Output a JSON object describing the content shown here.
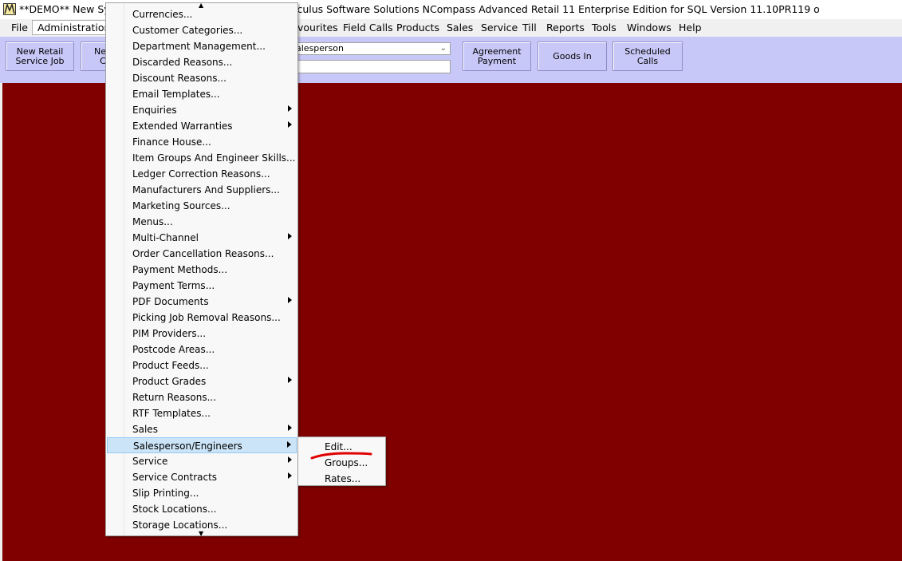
{
  "titlebar": {
    "left_text": "**DEMO** New Syst",
    "right_text": "lculus Software Solutions NCompass Advanced Retail 11 Enterprise Edition for SQL Version 11.10PR119 o"
  },
  "menubar": {
    "items": [
      "File",
      "Administration",
      "vourites",
      "Field Calls",
      "Products",
      "Sales",
      "Service",
      "Till",
      "Reports",
      "Tools",
      "Windows",
      "Help"
    ]
  },
  "toolbar": {
    "new_retail_service_job": "New Retail Service Job",
    "partial_button": "Ne C",
    "salesperson_select": "alesperson",
    "agreement_payment": "Agreement Payment",
    "goods_in": "Goods In",
    "scheduled_calls": "Scheduled Calls"
  },
  "admin_menu": {
    "items": [
      {
        "label": "Currencies...",
        "submenu": false
      },
      {
        "label": "Customer Categories...",
        "submenu": false
      },
      {
        "label": "Department Management...",
        "submenu": false
      },
      {
        "label": "Discarded Reasons...",
        "submenu": false
      },
      {
        "label": "Discount Reasons...",
        "submenu": false
      },
      {
        "label": "Email Templates...",
        "submenu": false
      },
      {
        "label": "Enquiries",
        "submenu": true
      },
      {
        "label": "Extended Warranties",
        "submenu": true
      },
      {
        "label": "Finance House...",
        "submenu": false
      },
      {
        "label": "Item Groups And Engineer Skills...",
        "submenu": false
      },
      {
        "label": "Ledger Correction Reasons...",
        "submenu": false
      },
      {
        "label": "Manufacturers And Suppliers...",
        "submenu": false
      },
      {
        "label": "Marketing Sources...",
        "submenu": false
      },
      {
        "label": "Menus...",
        "submenu": false
      },
      {
        "label": "Multi-Channel",
        "submenu": true
      },
      {
        "label": "Order Cancellation Reasons...",
        "submenu": false
      },
      {
        "label": "Payment Methods...",
        "submenu": false
      },
      {
        "label": "Payment Terms...",
        "submenu": false
      },
      {
        "label": "PDF Documents",
        "submenu": true
      },
      {
        "label": "Picking Job Removal Reasons...",
        "submenu": false
      },
      {
        "label": "PIM Providers...",
        "submenu": false
      },
      {
        "label": "Postcode Areas...",
        "submenu": false
      },
      {
        "label": "Product Feeds...",
        "submenu": false
      },
      {
        "label": "Product Grades",
        "submenu": true
      },
      {
        "label": "Return Reasons...",
        "submenu": false
      },
      {
        "label": "RTF Templates...",
        "submenu": false
      },
      {
        "label": "Sales",
        "submenu": true
      },
      {
        "label": "Salesperson/Engineers",
        "submenu": true,
        "highlighted": true
      },
      {
        "label": "Service",
        "submenu": true
      },
      {
        "label": "Service Contracts",
        "submenu": true
      },
      {
        "label": "Slip Printing...",
        "submenu": false
      },
      {
        "label": "Stock Locations...",
        "submenu": false
      },
      {
        "label": "Storage Locations...",
        "submenu": false
      }
    ]
  },
  "salesperson_submenu": {
    "items": [
      "Edit...",
      "Groups...",
      "Rates..."
    ]
  },
  "colors": {
    "toolbar_bg": "#c8c8f8",
    "workspace_bg": "#800000",
    "menu_highlight": "#cce4f7",
    "annotation_red": "#e00000"
  }
}
